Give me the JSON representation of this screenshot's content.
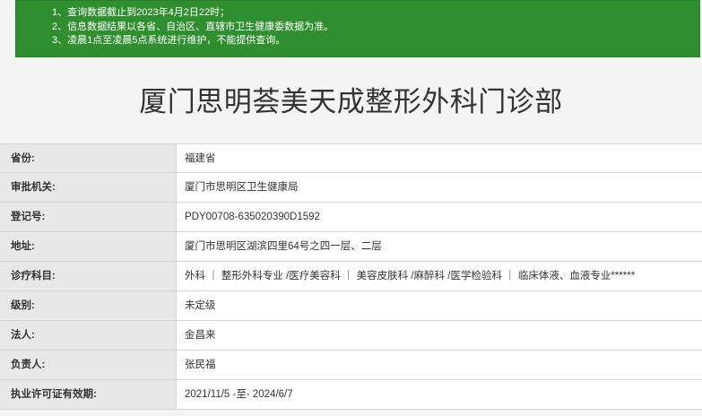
{
  "notice": {
    "line1": "1、查询数据截止到2023年4月2日22时；",
    "line2": "2、信息数据结果以各省、自治区、直辖市卫生健康委数据为准。",
    "line3": "3、凌晨1点至凌晨5点系统进行维护，不能提供查询。"
  },
  "title": "厦门思明荟美天成整形外科门诊部",
  "rows": [
    {
      "label": "省份:",
      "value": "福建省"
    },
    {
      "label": "审批机关:",
      "value": "厦门市思明区卫生健康局"
    },
    {
      "label": "登记号:",
      "value": "PDY00708-635020390D1592"
    },
    {
      "label": "地址:",
      "value": "厦门市思明区湖滨四里64号之四一层、二层"
    },
    {
      "label": "诊疗科目:",
      "value": "外科 ｜ 整形外科专业 /医疗美容科 ｜ 美容皮肤科 /麻醉科 /医学检验科 ｜ 临床体液、血液专业******"
    },
    {
      "label": "级别:",
      "value": "未定级"
    },
    {
      "label": "法人:",
      "value": "金昌来"
    },
    {
      "label": "负责人:",
      "value": "张民福"
    },
    {
      "label": "执业许可证有效期:",
      "value": "2021/11/5 -至- 2024/6/7"
    }
  ]
}
